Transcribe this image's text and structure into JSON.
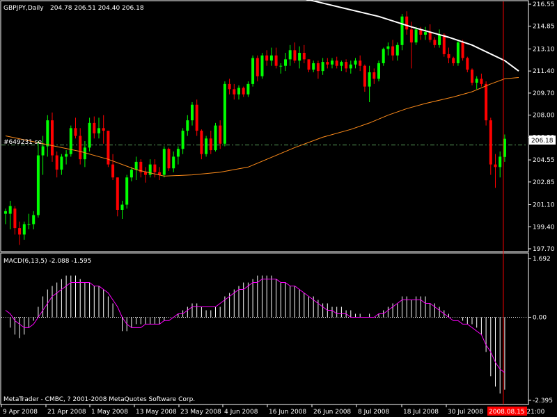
{
  "header": {
    "symbol": "GBPJPY,Daily",
    "ohlc": "204.78 206.51 204.40 206.18"
  },
  "price_tag": "206.18",
  "hline_label": "#649231 se",
  "macd_label": "MACD(6,13,5) -2.088 -1.595",
  "copyright": "MetaTrader - CMBC, ? 2001-2008 MetaQuotes Software Corp.",
  "current_time_label": "2008.08.15 21:00",
  "colors": {
    "bull": "#00ff00",
    "bear": "#ff0000",
    "ma_fast": "#ffffff",
    "ma_slow": "#ff8c1a",
    "macd_signal": "#ff00ff",
    "macd_hist": "#ffffff",
    "level": "#5a9e5a",
    "vline": "#ff0000"
  },
  "chart_data": [
    {
      "type": "candlestick",
      "title": "GBPJPY,Daily",
      "ylim": [
        197.7,
        216.55
      ],
      "yticks": [
        "216.55",
        "214.85",
        "213.10",
        "211.40",
        "209.70",
        "208.00",
        "206.30",
        "204.55",
        "202.85",
        "201.10",
        "199.40",
        "197.70"
      ],
      "xticks": [
        "9 Apr 2008",
        "21 Apr 2008",
        "1 May 2008",
        "13 May 2008",
        "23 May 2008",
        "4 Jun 2008",
        "16 Jun 2008",
        "26 Jun 2008",
        "8 Jul 2008",
        "18 Jul 2008",
        "30 Jul 2008"
      ],
      "last_price": 206.18,
      "level": 205.7,
      "candles": [
        [
          200.4,
          200.8,
          199.6,
          200.6
        ],
        [
          200.4,
          201.4,
          199.2,
          201.0
        ],
        [
          200.8,
          201.0,
          198.8,
          199.3
        ],
        [
          199.3,
          199.8,
          198.0,
          198.8
        ],
        [
          198.8,
          199.8,
          198.4,
          199.6
        ],
        [
          199.6,
          200.4,
          199.2,
          199.6
        ],
        [
          199.6,
          200.6,
          199.2,
          200.3
        ],
        [
          200.3,
          206.0,
          200.1,
          204.9
        ],
        [
          204.9,
          206.4,
          203.4,
          205.6
        ],
        [
          205.6,
          208.0,
          204.8,
          207.6
        ],
        [
          207.6,
          208.2,
          204.4,
          204.9
        ],
        [
          204.9,
          205.2,
          203.2,
          203.8
        ],
        [
          203.8,
          205.0,
          203.4,
          204.8
        ],
        [
          204.8,
          205.3,
          204.2,
          205.0
        ],
        [
          205.0,
          207.2,
          204.8,
          207.0
        ],
        [
          207.0,
          207.8,
          206.2,
          206.4
        ],
        [
          206.4,
          207.0,
          204.2,
          204.6
        ],
        [
          204.6,
          206.0,
          204.0,
          205.5
        ],
        [
          205.5,
          207.8,
          205.2,
          207.4
        ],
        [
          207.4,
          207.9,
          206.2,
          206.6
        ],
        [
          206.6,
          207.8,
          206.2,
          207.0
        ],
        [
          207.0,
          208.0,
          205.8,
          206.8
        ],
        [
          206.8,
          206.8,
          204.0,
          204.2
        ],
        [
          204.2,
          205.0,
          203.0,
          203.2
        ],
        [
          203.2,
          203.2,
          200.2,
          200.7
        ],
        [
          200.7,
          201.4,
          200.0,
          201.1
        ],
        [
          201.1,
          203.4,
          200.8,
          203.2
        ],
        [
          203.2,
          204.0,
          202.9,
          203.8
        ],
        [
          203.8,
          204.8,
          203.0,
          204.4
        ],
        [
          204.4,
          204.6,
          203.2,
          203.6
        ],
        [
          203.6,
          204.0,
          202.8,
          203.4
        ],
        [
          203.4,
          204.6,
          203.2,
          204.2
        ],
        [
          204.2,
          204.6,
          203.2,
          203.6
        ],
        [
          203.6,
          204.0,
          203.0,
          203.4
        ],
        [
          203.4,
          205.6,
          203.2,
          205.4
        ],
        [
          205.4,
          205.5,
          203.7,
          203.9
        ],
        [
          203.9,
          205.2,
          203.6,
          204.8
        ],
        [
          204.8,
          205.6,
          204.2,
          205.4
        ],
        [
          205.4,
          207.0,
          205.0,
          206.8
        ],
        [
          206.8,
          208.0,
          206.4,
          207.6
        ],
        [
          207.6,
          209.0,
          207.2,
          208.8
        ],
        [
          208.8,
          209.2,
          206.4,
          206.8
        ],
        [
          206.8,
          206.9,
          204.6,
          205.0
        ],
        [
          205.0,
          206.4,
          204.8,
          206.2
        ],
        [
          206.2,
          206.8,
          205.0,
          205.3
        ],
        [
          205.3,
          207.4,
          205.2,
          207.2
        ],
        [
          207.2,
          207.6,
          205.4,
          205.8
        ],
        [
          205.8,
          210.6,
          205.6,
          210.4
        ],
        [
          210.4,
          210.8,
          209.6,
          210.0
        ],
        [
          210.0,
          210.4,
          209.2,
          209.6
        ],
        [
          209.6,
          210.3,
          209.2,
          210.1
        ],
        [
          210.1,
          210.2,
          209.4,
          209.6
        ],
        [
          209.6,
          210.6,
          209.4,
          210.4
        ],
        [
          210.4,
          212.6,
          210.2,
          212.4
        ],
        [
          212.4,
          212.6,
          210.6,
          211.0
        ],
        [
          211.0,
          212.8,
          210.8,
          212.6
        ],
        [
          212.6,
          213.0,
          211.8,
          212.2
        ],
        [
          212.2,
          213.2,
          211.8,
          212.6
        ],
        [
          212.6,
          213.2,
          211.6,
          211.8
        ],
        [
          211.8,
          212.0,
          211.2,
          211.8
        ],
        [
          211.8,
          212.8,
          211.4,
          212.3
        ],
        [
          212.3,
          213.4,
          211.8,
          213.0
        ],
        [
          213.0,
          213.6,
          212.0,
          212.2
        ],
        [
          212.2,
          213.3,
          211.6,
          212.8
        ],
        [
          212.8,
          213.4,
          212.0,
          212.3
        ],
        [
          212.3,
          212.3,
          211.3,
          211.5
        ],
        [
          211.5,
          212.2,
          211.3,
          212.0
        ],
        [
          212.0,
          212.2,
          210.8,
          211.4
        ],
        [
          211.4,
          212.4,
          211.1,
          212.1
        ],
        [
          212.1,
          212.4,
          211.6,
          211.9
        ],
        [
          211.9,
          212.4,
          211.6,
          212.2
        ],
        [
          212.2,
          212.5,
          211.6,
          211.8
        ],
        [
          211.8,
          212.2,
          211.4,
          212.1
        ],
        [
          212.1,
          212.3,
          211.3,
          211.6
        ],
        [
          211.6,
          212.2,
          211.2,
          211.9
        ],
        [
          211.9,
          212.4,
          211.6,
          212.2
        ],
        [
          212.2,
          212.6,
          211.4,
          211.8
        ],
        [
          211.8,
          211.9,
          209.8,
          210.2
        ],
        [
          210.2,
          211.8,
          209.0,
          211.3
        ],
        [
          211.3,
          211.6,
          210.4,
          210.8
        ],
        [
          210.8,
          212.2,
          210.6,
          212.0
        ],
        [
          212.0,
          213.2,
          211.8,
          213.1
        ],
        [
          213.1,
          213.6,
          212.6,
          213.3
        ],
        [
          213.3,
          213.8,
          212.2,
          212.6
        ],
        [
          212.6,
          213.6,
          212.2,
          213.4
        ],
        [
          213.4,
          215.8,
          213.0,
          215.6
        ],
        [
          215.6,
          216.0,
          214.2,
          214.6
        ],
        [
          214.6,
          215.2,
          211.6,
          213.6
        ],
        [
          213.6,
          214.8,
          213.4,
          214.6
        ],
        [
          214.6,
          214.8,
          213.8,
          214.2
        ],
        [
          214.2,
          214.8,
          213.8,
          214.4
        ],
        [
          214.4,
          215.0,
          213.6,
          213.8
        ],
        [
          213.8,
          214.0,
          213.2,
          213.4
        ],
        [
          213.4,
          214.6,
          213.2,
          214.2
        ],
        [
          214.2,
          214.3,
          212.5,
          212.7
        ],
        [
          212.7,
          213.2,
          212.0,
          212.4
        ],
        [
          212.4,
          212.5,
          211.8,
          212.0
        ],
        [
          212.0,
          213.8,
          211.8,
          213.6
        ],
        [
          213.6,
          213.8,
          212.2,
          212.4
        ],
        [
          212.4,
          212.5,
          211.3,
          211.5
        ],
        [
          211.5,
          211.6,
          210.3,
          210.5
        ],
        [
          210.5,
          211.0,
          210.0,
          210.8
        ],
        [
          210.8,
          211.2,
          210.2,
          210.4
        ],
        [
          210.4,
          210.6,
          207.2,
          207.6
        ],
        [
          207.6,
          207.8,
          203.4,
          204.2
        ],
        [
          204.2,
          205.0,
          202.4,
          204.0
        ],
        [
          204.0,
          205.2,
          203.2,
          204.8
        ],
        [
          204.78,
          206.51,
          204.4,
          206.18
        ]
      ],
      "ma_fast_name": "MA fast",
      "ma_fast": [
        [
          40,
          218.8
        ],
        [
          55,
          217.6
        ],
        [
          66,
          216.8
        ],
        [
          80,
          215.6
        ],
        [
          87,
          214.8
        ],
        [
          95,
          214.0
        ],
        [
          100,
          213.4
        ],
        [
          107,
          212.2
        ],
        [
          110,
          211.4
        ]
      ],
      "ma_slow": [
        [
          0,
          206.4
        ],
        [
          8,
          205.8
        ],
        [
          16,
          205.2
        ],
        [
          22,
          204.6
        ],
        [
          28,
          203.8
        ],
        [
          34,
          203.3
        ],
        [
          40,
          203.4
        ],
        [
          46,
          203.6
        ],
        [
          52,
          204.0
        ],
        [
          56,
          204.6
        ],
        [
          62,
          205.5
        ],
        [
          68,
          206.3
        ],
        [
          74,
          206.9
        ],
        [
          78,
          207.4
        ],
        [
          82,
          208.0
        ],
        [
          86,
          208.5
        ],
        [
          90,
          208.9
        ],
        [
          96,
          209.4
        ],
        [
          100,
          209.8
        ],
        [
          104,
          210.4
        ],
        [
          107,
          210.8
        ],
        [
          110,
          210.9
        ]
      ]
    },
    {
      "type": "macd",
      "title": "MACD(6,13,5)",
      "ylim": [
        -2.395,
        1.692
      ],
      "yticks": [
        "1.692",
        "0.00",
        "-2.395"
      ],
      "macd_value": -2.088,
      "signal_value": -1.595,
      "histogram": [
        0.0,
        -0.3,
        -0.5,
        -0.6,
        -0.5,
        -0.3,
        -0.1,
        0.3,
        0.6,
        0.8,
        0.9,
        1.0,
        1.1,
        1.2,
        1.2,
        1.2,
        1.1,
        1.0,
        1.0,
        0.9,
        0.9,
        0.8,
        0.6,
        0.4,
        0.0,
        -0.4,
        -0.4,
        -0.3,
        -0.2,
        -0.2,
        -0.2,
        -0.2,
        -0.2,
        -0.2,
        -0.1,
        0.0,
        0.0,
        0.1,
        0.2,
        0.3,
        0.4,
        0.4,
        0.3,
        0.2,
        0.2,
        0.3,
        0.3,
        0.6,
        0.7,
        0.8,
        0.9,
        1.0,
        1.0,
        1.1,
        1.2,
        1.2,
        1.2,
        1.2,
        1.1,
        1.0,
        1.0,
        0.9,
        0.9,
        0.8,
        0.7,
        0.6,
        0.6,
        0.5,
        0.4,
        0.4,
        0.3,
        0.3,
        0.3,
        0.2,
        0.2,
        0.1,
        0.1,
        0.0,
        0.1,
        0.0,
        0.1,
        0.2,
        0.3,
        0.4,
        0.4,
        0.6,
        0.6,
        0.5,
        0.6,
        0.6,
        0.6,
        0.4,
        0.4,
        0.3,
        0.2,
        0.1,
        0.0,
        0.0,
        -0.1,
        -0.2,
        -0.2,
        -0.3,
        -0.5,
        -1.0,
        -1.7,
        -2.0,
        -2.2,
        -2.088
      ],
      "signal": [
        0.2,
        0.1,
        -0.1,
        -0.2,
        -0.3,
        -0.3,
        -0.2,
        0.0,
        0.2,
        0.4,
        0.6,
        0.7,
        0.8,
        0.9,
        1.0,
        1.0,
        1.0,
        1.0,
        1.0,
        0.9,
        0.9,
        0.8,
        0.7,
        0.5,
        0.3,
        0.0,
        -0.2,
        -0.3,
        -0.3,
        -0.3,
        -0.2,
        -0.2,
        -0.2,
        -0.2,
        -0.1,
        -0.1,
        0.0,
        0.1,
        0.1,
        0.2,
        0.3,
        0.3,
        0.3,
        0.3,
        0.3,
        0.3,
        0.4,
        0.5,
        0.6,
        0.7,
        0.8,
        0.8,
        0.9,
        1.0,
        1.0,
        1.1,
        1.1,
        1.1,
        1.1,
        1.0,
        1.0,
        0.9,
        0.9,
        0.8,
        0.7,
        0.6,
        0.5,
        0.4,
        0.3,
        0.2,
        0.2,
        0.1,
        0.1,
        0.1,
        0.0,
        0.0,
        0.0,
        0.0,
        0.0,
        0.0,
        0.1,
        0.1,
        0.2,
        0.3,
        0.4,
        0.5,
        0.5,
        0.5,
        0.5,
        0.5,
        0.4,
        0.4,
        0.3,
        0.2,
        0.1,
        0.0,
        -0.1,
        -0.1,
        -0.2,
        -0.2,
        -0.3,
        -0.4,
        -0.5,
        -0.8,
        -1.0,
        -1.3,
        -1.5,
        -1.595
      ]
    }
  ]
}
